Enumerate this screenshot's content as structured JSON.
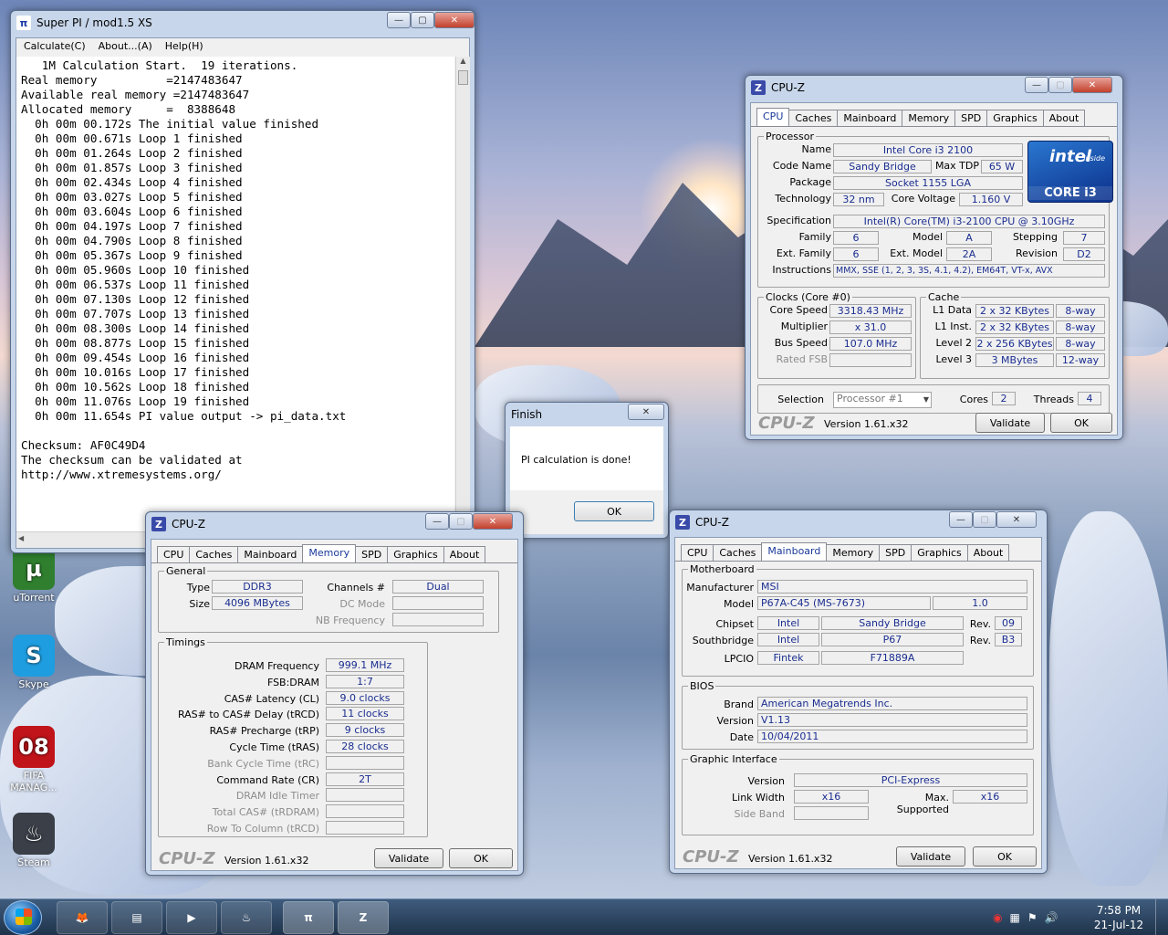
{
  "desktop": {
    "icons": [
      {
        "label": "uTorrent",
        "glyph": "µ",
        "color": "#2f7f2f"
      },
      {
        "label": "Skype",
        "glyph": "S",
        "color": "#1e9de0"
      },
      {
        "label": "FIFA MANAG...",
        "glyph": "08",
        "color": "#c0141a"
      },
      {
        "label": "Steam",
        "glyph": "♨",
        "color": "#3a3f48"
      }
    ]
  },
  "superpi": {
    "title": "Super PI / mod1.5 XS",
    "menu": [
      "Calculate(C)",
      "About...(A)",
      "Help(H)"
    ],
    "lines": [
      "   1M Calculation Start.  19 iterations.",
      "Real memory          =2147483647",
      "Available real memory =2147483647",
      "Allocated memory     =  8388648",
      "  0h 00m 00.172s The initial value finished",
      "  0h 00m 00.671s Loop 1 finished",
      "  0h 00m 01.264s Loop 2 finished",
      "  0h 00m 01.857s Loop 3 finished",
      "  0h 00m 02.434s Loop 4 finished",
      "  0h 00m 03.027s Loop 5 finished",
      "  0h 00m 03.604s Loop 6 finished",
      "  0h 00m 04.197s Loop 7 finished",
      "  0h 00m 04.790s Loop 8 finished",
      "  0h 00m 05.367s Loop 9 finished",
      "  0h 00m 05.960s Loop 10 finished",
      "  0h 00m 06.537s Loop 11 finished",
      "  0h 00m 07.130s Loop 12 finished",
      "  0h 00m 07.707s Loop 13 finished",
      "  0h 00m 08.300s Loop 14 finished",
      "  0h 00m 08.877s Loop 15 finished",
      "  0h 00m 09.454s Loop 16 finished",
      "  0h 00m 10.016s Loop 17 finished",
      "  0h 00m 10.562s Loop 18 finished",
      "  0h 00m 11.076s Loop 19 finished",
      "  0h 00m 11.654s PI value output -> pi_data.txt",
      "",
      "Checksum: AF0C49D4",
      "The checksum can be validated at",
      "http://www.xtremesystems.org/"
    ]
  },
  "finish": {
    "title": "Finish",
    "message": "PI calculation is done!",
    "ok": "OK"
  },
  "cpuz_common": {
    "tabs": [
      "CPU",
      "Caches",
      "Mainboard",
      "Memory",
      "SPD",
      "Graphics",
      "About"
    ],
    "logo": "CPU-Z",
    "version": "Version 1.61.x32",
    "validate": "Validate",
    "ok": "OK",
    "title": "CPU-Z"
  },
  "cpu": {
    "processor_group": "Processor",
    "name_label": "Name",
    "name": "Intel Core i3 2100",
    "codename_label": "Code Name",
    "codename": "Sandy Bridge",
    "maxtdp_label": "Max TDP",
    "maxtdp": "65 W",
    "package_label": "Package",
    "package": "Socket 1155 LGA",
    "technology_label": "Technology",
    "technology": "32 nm",
    "voltage_label": "Core Voltage",
    "voltage": "1.160 V",
    "spec_label": "Specification",
    "spec": "Intel(R) Core(TM) i3-2100 CPU @ 3.10GHz",
    "family_label": "Family",
    "family": "6",
    "model_label": "Model",
    "model": "A",
    "stepping_label": "Stepping",
    "stepping": "7",
    "extfamily_label": "Ext. Family",
    "extfamily": "6",
    "extmodel_label": "Ext. Model",
    "extmodel": "2A",
    "revision_label": "Revision",
    "revision": "D2",
    "instr_label": "Instructions",
    "instr": "MMX, SSE (1, 2, 3, 3S, 4.1, 4.2), EM64T, VT-x, AVX",
    "clocks_group": "Clocks (Core #0)",
    "corespeed_label": "Core Speed",
    "corespeed": "3318.43 MHz",
    "mult_label": "Multiplier",
    "mult": "x 31.0",
    "bus_label": "Bus Speed",
    "bus": "107.0 MHz",
    "ratedfsb_label": "Rated FSB",
    "ratedfsb": "",
    "cache_group": "Cache",
    "l1d_label": "L1 Data",
    "l1d": "2 x 32 KBytes",
    "l1d_way": "8-way",
    "l1i_label": "L1 Inst.",
    "l1i": "2 x 32 KBytes",
    "l1i_way": "8-way",
    "l2_label": "Level 2",
    "l2": "2 x 256 KBytes",
    "l2_way": "8-way",
    "l3_label": "Level 3",
    "l3": "3 MBytes",
    "l3_way": "12-way",
    "selection_label": "Selection",
    "selection": "Processor #1",
    "cores_label": "Cores",
    "cores": "2",
    "threads_label": "Threads",
    "threads": "4",
    "intel_logo": {
      "top": "intel",
      "inside": "inside",
      "bottom": "CORE i3"
    }
  },
  "memory": {
    "general_group": "General",
    "type_label": "Type",
    "type": "DDR3",
    "size_label": "Size",
    "size": "4096 MBytes",
    "channels_label": "Channels #",
    "channels": "Dual",
    "dcmode_label": "DC Mode",
    "dcmode": "",
    "nbfreq_label": "NB Frequency",
    "nbfreq": "",
    "timings_group": "Timings",
    "timings": [
      {
        "label": "DRAM Frequency",
        "value": "999.1 MHz",
        "disabled": false
      },
      {
        "label": "FSB:DRAM",
        "value": "1:7",
        "disabled": false
      },
      {
        "label": "CAS# Latency (CL)",
        "value": "9.0 clocks",
        "disabled": false
      },
      {
        "label": "RAS# to CAS# Delay (tRCD)",
        "value": "11 clocks",
        "disabled": false
      },
      {
        "label": "RAS# Precharge (tRP)",
        "value": "9 clocks",
        "disabled": false
      },
      {
        "label": "Cycle Time (tRAS)",
        "value": "28 clocks",
        "disabled": false
      },
      {
        "label": "Bank Cycle Time (tRC)",
        "value": "",
        "disabled": true
      },
      {
        "label": "Command Rate (CR)",
        "value": "2T",
        "disabled": false
      },
      {
        "label": "DRAM Idle Timer",
        "value": "",
        "disabled": true
      },
      {
        "label": "Total CAS# (tRDRAM)",
        "value": "",
        "disabled": true
      },
      {
        "label": "Row To Column (tRCD)",
        "value": "",
        "disabled": true
      }
    ]
  },
  "mainboard": {
    "mb_group": "Motherboard",
    "manu_label": "Manufacturer",
    "manu": "MSI",
    "model_label": "Model",
    "model": "P67A-C45 (MS-7673)",
    "model_rev": "1.0",
    "chipset_label": "Chipset",
    "chipset_vendor": "Intel",
    "chipset": "Sandy Bridge",
    "chipset_rev_label": "Rev.",
    "chipset_rev": "09",
    "south_label": "Southbridge",
    "south_vendor": "Intel",
    "south": "P67",
    "south_rev_label": "Rev.",
    "south_rev": "B3",
    "lpcio_label": "LPCIO",
    "lpcio_vendor": "Fintek",
    "lpcio": "F71889A",
    "bios_group": "BIOS",
    "brand_label": "Brand",
    "brand": "American Megatrends Inc.",
    "version_label": "Version",
    "version": "V1.13",
    "date_label": "Date",
    "date": "10/04/2011",
    "gi_group": "Graphic Interface",
    "giver_label": "Version",
    "giver": "PCI-Express",
    "lw_label": "Link Width",
    "lw": "x16",
    "maxsup_label": "Max. Supported",
    "maxsup": "x16",
    "sideband_label": "Side Band",
    "sideband": ""
  },
  "taskbar": {
    "items": [
      {
        "name": "firefox",
        "glyph": "🦊"
      },
      {
        "name": "explorer",
        "glyph": "▤"
      },
      {
        "name": "media",
        "glyph": "▶"
      },
      {
        "name": "steam",
        "glyph": "♨"
      },
      {
        "name": "superpi",
        "glyph": "π"
      },
      {
        "name": "cpuz",
        "glyph": "Z"
      }
    ],
    "time": "7:58 PM",
    "date": "21-Jul-12"
  }
}
